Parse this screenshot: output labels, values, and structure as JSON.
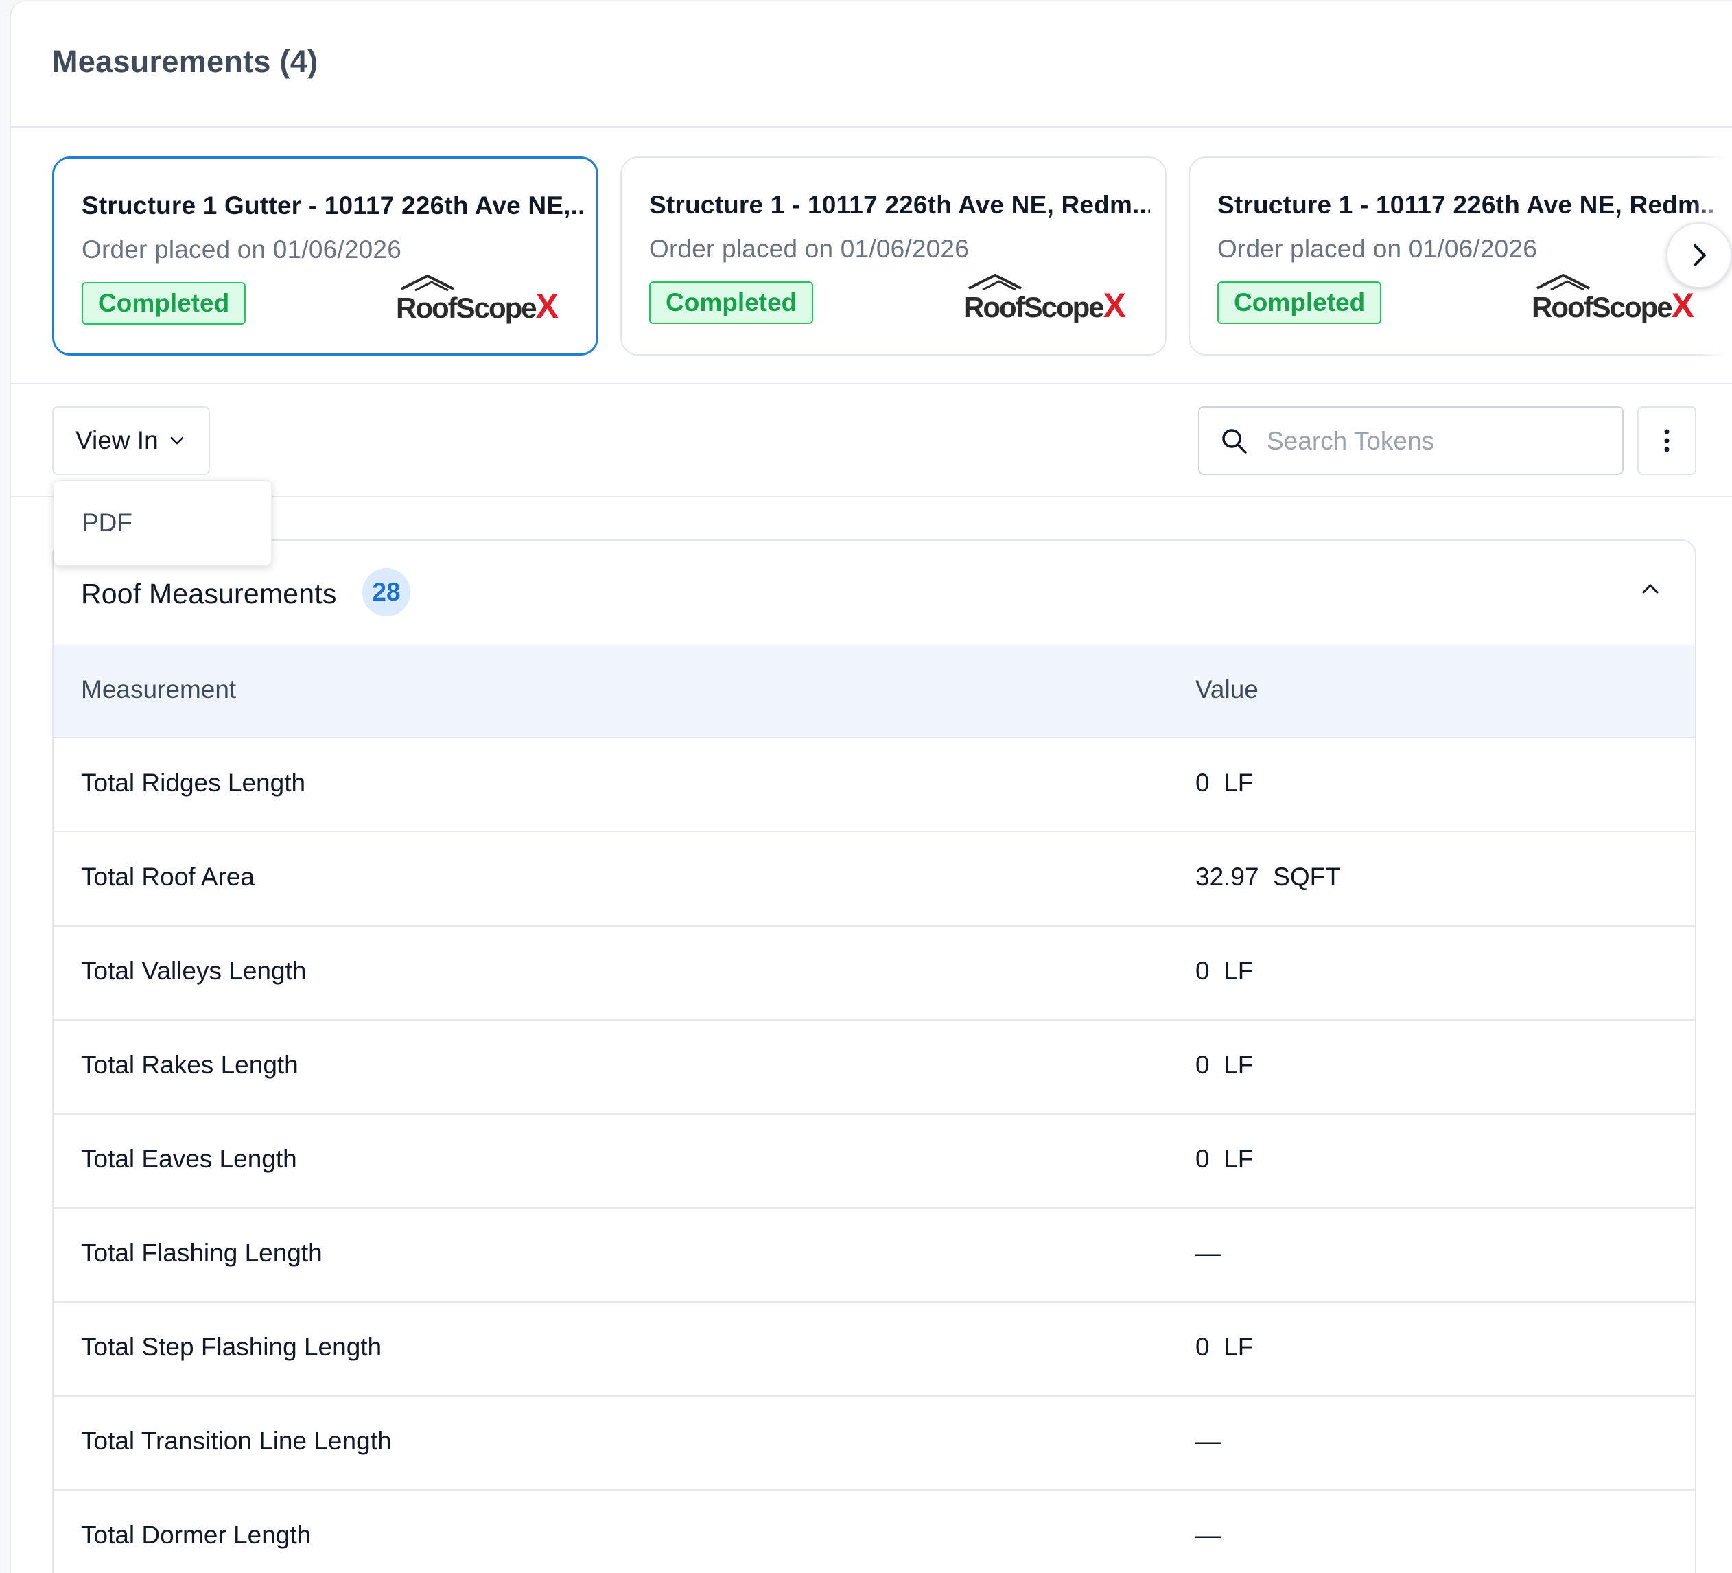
{
  "header": {
    "title": "Measurements (4)"
  },
  "cards": [
    {
      "title": "Structure 1 Gutter - 10117 226th Ave NE,...",
      "subtitle": "Order placed on 01/06/2026",
      "status": "Completed",
      "logo_text": "RoofScope",
      "logo_x": "X",
      "selected": true
    },
    {
      "title": "Structure 1 - 10117 226th Ave NE, Redm...",
      "subtitle": "Order placed on 01/06/2026",
      "status": "Completed",
      "logo_text": "RoofScope",
      "logo_x": "X",
      "selected": false
    },
    {
      "title": "Structure 1 - 10117 226th Ave NE, Redm..",
      "subtitle": "Order placed on 01/06/2026",
      "status": "Completed",
      "logo_text": "RoofScope",
      "logo_x": "X",
      "selected": false
    }
  ],
  "toolbar": {
    "view_in_label": "View In",
    "view_in_options": [
      "PDF"
    ],
    "search_placeholder": "Search Tokens"
  },
  "section": {
    "title": "Roof Measurements",
    "count": "28",
    "columns": [
      "Measurement",
      "Value"
    ],
    "rows": [
      {
        "name": "Total Ridges Length",
        "value": "0  LF"
      },
      {
        "name": "Total Roof Area",
        "value": "32.97  SQFT"
      },
      {
        "name": "Total Valleys Length",
        "value": "0  LF"
      },
      {
        "name": "Total Rakes Length",
        "value": "0  LF"
      },
      {
        "name": "Total Eaves Length",
        "value": "0  LF"
      },
      {
        "name": "Total Flashing Length",
        "value": "—"
      },
      {
        "name": "Total Step Flashing Length",
        "value": "0  LF"
      },
      {
        "name": "Total Transition Line Length",
        "value": "—"
      },
      {
        "name": "Total Dormer Length",
        "value": "—"
      }
    ]
  },
  "colors": {
    "accent": "#1e7fd6",
    "success_text": "#16a34a",
    "success_bg": "#dcfce7",
    "logo_red": "#e11d2c"
  },
  "icons": {
    "next": "chevron-right-icon",
    "search": "search-icon",
    "more": "kebab-vertical-icon",
    "collapse": "chevron-up-icon",
    "dropdown": "chevron-down-icon"
  }
}
